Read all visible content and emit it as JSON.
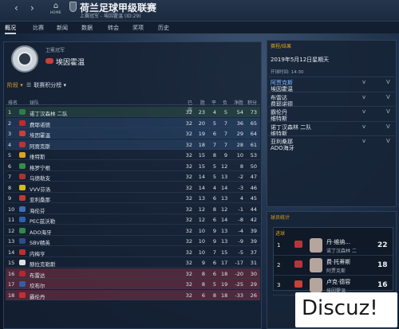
{
  "window": {
    "title": "荷兰足球甲级联赛",
    "subtitle": "上赛冠军 - 埃因霍温 (ID:29)",
    "back_icon": "chevron-left-icon",
    "forward_icon": "chevron-right-icon",
    "home_icon": "home-icon",
    "home_label": "HOME"
  },
  "tabs": [
    {
      "label": "概况"
    },
    {
      "label": "比赛"
    },
    {
      "label": "新闻"
    },
    {
      "label": "数据"
    },
    {
      "label": "转会"
    },
    {
      "label": "奖项"
    },
    {
      "label": "历史"
    }
  ],
  "champion": {
    "label": "卫冕冠军",
    "team": "埃因霍温"
  },
  "table": {
    "stage_label": "阶段",
    "filter_label": "联赛积分榜",
    "headers": [
      "排名",
      "球队",
      "已赛",
      "胜",
      "平",
      "负",
      "净胜",
      "积分"
    ],
    "rows": [
      {
        "pos": "1",
        "team": "诺丁汉森林 二队",
        "p": "32",
        "w": "23",
        "d": "4",
        "l": "5",
        "gd": "54",
        "pts": "73",
        "zone": "top",
        "color": "#2f7d4a"
      },
      {
        "pos": "2",
        "team": "费耶诺德",
        "p": "32",
        "w": "20",
        "d": "5",
        "l": "7",
        "gd": "36",
        "pts": "65",
        "zone": "mid",
        "color": "#c4282f"
      },
      {
        "pos": "3",
        "team": "埃因霍温",
        "p": "32",
        "w": "19",
        "d": "6",
        "l": "7",
        "gd": "29",
        "pts": "64",
        "zone": "mid",
        "color": "#c94037"
      },
      {
        "pos": "4",
        "team": "阿贾克斯",
        "p": "32",
        "w": "18",
        "d": "7",
        "l": "7",
        "gd": "28",
        "pts": "61",
        "zone": "mid",
        "color": "#b8343a"
      },
      {
        "pos": "5",
        "team": "维特斯",
        "p": "32",
        "w": "15",
        "d": "8",
        "l": "9",
        "gd": "10",
        "pts": "53",
        "zone": "",
        "color": "#d9a520"
      },
      {
        "pos": "6",
        "team": "格罗宁根",
        "p": "32",
        "w": "15",
        "d": "5",
        "l": "12",
        "gd": "8",
        "pts": "50",
        "zone": "",
        "color": "#3a8a4a"
      },
      {
        "pos": "7",
        "team": "乌德勒支",
        "p": "32",
        "w": "14",
        "d": "5",
        "l": "13",
        "gd": "-2",
        "pts": "47",
        "zone": "",
        "color": "#b03030"
      },
      {
        "pos": "8",
        "team": "VVV芬洛",
        "p": "32",
        "w": "14",
        "d": "4",
        "l": "14",
        "gd": "-3",
        "pts": "46",
        "zone": "",
        "color": "#d8b820"
      },
      {
        "pos": "9",
        "team": "亚利桑那",
        "p": "32",
        "w": "13",
        "d": "6",
        "l": "13",
        "gd": "4",
        "pts": "45",
        "zone": "",
        "color": "#c33838"
      },
      {
        "pos": "10",
        "team": "海伦芬",
        "p": "32",
        "w": "12",
        "d": "8",
        "l": "12",
        "gd": "-1",
        "pts": "44",
        "zone": "",
        "color": "#3d6fb8"
      },
      {
        "pos": "11",
        "team": "PEC兹沃勒",
        "p": "32",
        "w": "12",
        "d": "6",
        "l": "14",
        "gd": "-8",
        "pts": "42",
        "zone": "",
        "color": "#2f5fa8"
      },
      {
        "pos": "12",
        "team": "ADO海牙",
        "p": "32",
        "w": "10",
        "d": "9",
        "l": "13",
        "gd": "-4",
        "pts": "39",
        "zone": "",
        "color": "#2f8a4a"
      },
      {
        "pos": "13",
        "team": "SBV精英",
        "p": "32",
        "w": "10",
        "d": "9",
        "l": "13",
        "gd": "-9",
        "pts": "39",
        "zone": "",
        "color": "#2c4e8c"
      },
      {
        "pos": "14",
        "team": "内梅亨",
        "p": "32",
        "w": "10",
        "d": "7",
        "l": "15",
        "gd": "-5",
        "pts": "37",
        "zone": "",
        "color": "#b83030"
      },
      {
        "pos": "15",
        "team": "赫拉克勒斯",
        "p": "32",
        "w": "9",
        "d": "6",
        "l": "17",
        "gd": "-17",
        "pts": "31",
        "zone": "",
        "color": "#e0e0e0"
      },
      {
        "pos": "16",
        "team": "布雷达",
        "p": "32",
        "w": "8",
        "d": "6",
        "l": "18",
        "gd": "-20",
        "pts": "30",
        "zone": "rel",
        "color": "#b02a30"
      },
      {
        "pos": "17",
        "team": "坎布尔",
        "p": "32",
        "w": "8",
        "d": "5",
        "l": "19",
        "gd": "-25",
        "pts": "29",
        "zone": "rel",
        "color": "#2f5fa8"
      },
      {
        "pos": "18",
        "team": "霸伦丹",
        "p": "32",
        "w": "6",
        "d": "8",
        "l": "18",
        "gd": "-33",
        "pts": "26",
        "zone": "rel",
        "color": "#c43030"
      }
    ]
  },
  "fixtures": {
    "title": "赛程/结果",
    "date": "2019年5月12日星期天",
    "time": "开球时间: 14:30",
    "vs": "v",
    "arrow": "V",
    "matches": [
      {
        "home": "阿贾克斯",
        "away": "埃因霍温",
        "highlight": true
      },
      {
        "home": "布雷达",
        "away": "费耶诺德",
        "highlight": false
      },
      {
        "home": "霸伦丹",
        "away": "维特斯",
        "highlight": false
      },
      {
        "home": "诺丁汉森林 二队",
        "away": "维特斯",
        "highlight": false
      },
      {
        "home": "亚利桑那",
        "away": "ADO海牙",
        "highlight": false
      }
    ]
  },
  "scorers": {
    "title": "球员统计",
    "subtitle": "进球",
    "rows": [
      {
        "rank": "1",
        "name": "丹·维纳…",
        "team": "诺丁汉森林 二",
        "goals": "22",
        "club_color": "#b8343a"
      },
      {
        "rank": "2",
        "name": "费·托蒂斯",
        "team": "阿贾克斯",
        "goals": "18",
        "club_color": "#b8343a"
      },
      {
        "rank": "3",
        "name": "卢克·德容",
        "team": "埃因霍温",
        "goals": "16",
        "club_color": "#c94037"
      }
    ]
  },
  "watermark": "Discuz!"
}
